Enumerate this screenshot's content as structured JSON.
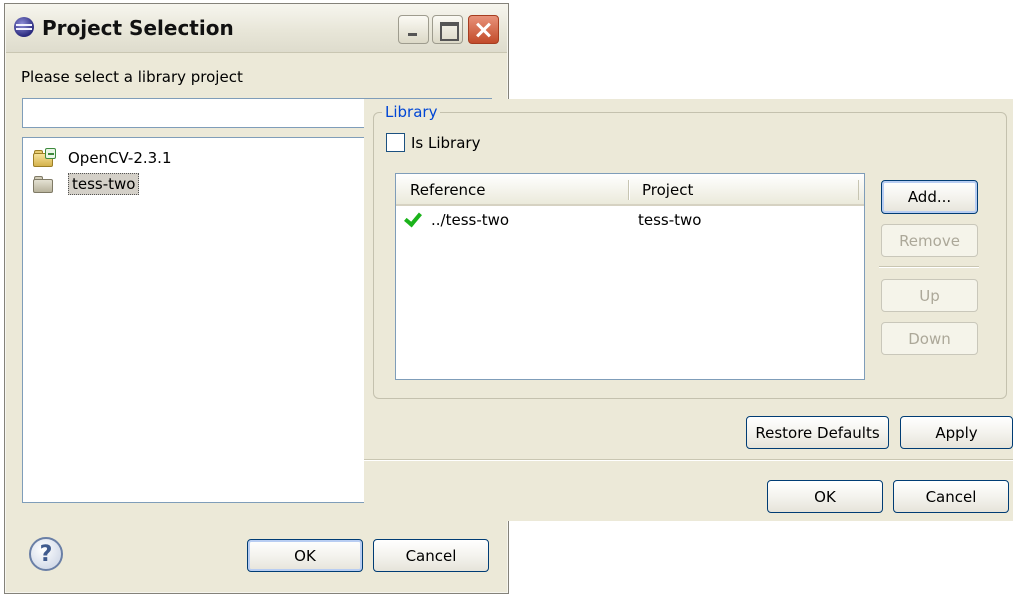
{
  "project_dialog": {
    "title": "Project Selection",
    "prompt": "Please select a library project",
    "filter_value": "",
    "projects": [
      {
        "name": "OpenCV-2.3.1",
        "open": true,
        "selected": false
      },
      {
        "name": "tess-two",
        "open": false,
        "selected": true
      }
    ],
    "help_glyph": "?",
    "ok_label": "OK",
    "cancel_label": "Cancel"
  },
  "library_panel": {
    "group_label": "Library",
    "is_library_label": "Is Library",
    "is_library_checked": false,
    "columns": [
      "Reference",
      "Project"
    ],
    "rows": [
      {
        "reference": "../tess-two",
        "project": "tess-two",
        "status_icon": "checkmark-icon"
      }
    ],
    "buttons": {
      "add": "Add...",
      "remove": "Remove",
      "up": "Up",
      "down": "Down"
    },
    "restore_defaults_label": "Restore Defaults",
    "apply_label": "Apply",
    "ok_label": "OK",
    "cancel_label": "Cancel"
  },
  "colors": {
    "dialog_bg": "#ece9d8",
    "group_label": "#0046d5",
    "check_mark": "#1bb31b",
    "button_border": "#003c74"
  }
}
